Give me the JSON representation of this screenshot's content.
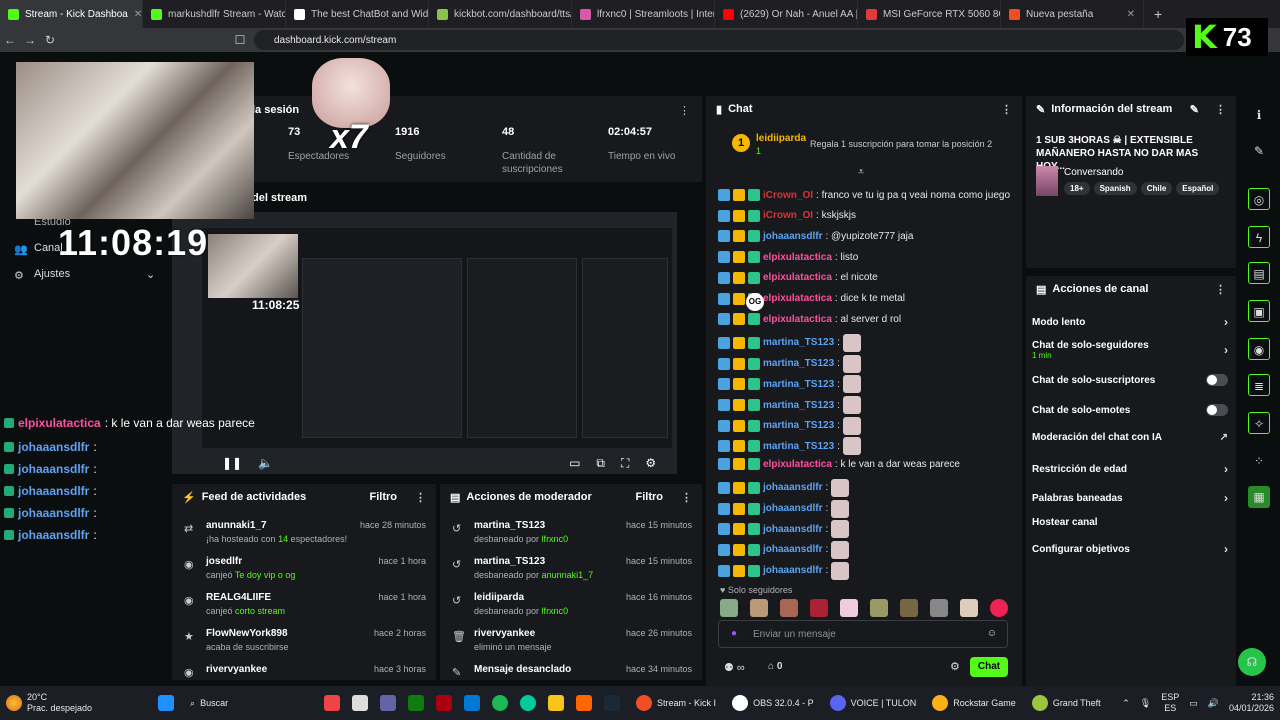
{
  "browser": {
    "tabs": [
      {
        "label": "Stream - Kick Dashboa",
        "color": "#53fc18",
        "active": true
      },
      {
        "label": "markushdlfr Stream - Watch L",
        "color": "#53fc18"
      },
      {
        "label": "The best ChatBot and Wid",
        "color": "#ffffff"
      },
      {
        "label": "kickbot.com/dashboard/tts/co",
        "color": "#8bc34a"
      },
      {
        "label": "lfrxnc0 | Streamloots | Interac",
        "color": "#d85aa6"
      },
      {
        "label": "(2629) Or Nah - Anuel AA | Sp",
        "color": "#ff0000"
      },
      {
        "label": "MSI GeForce RTX 5060 8G SHA",
        "color": "#e03a3a"
      },
      {
        "label": "Nueva pestaña",
        "color": "#f04e23"
      }
    ],
    "url": "dashboard.kick.com/stream"
  },
  "counter": {
    "logo": "K",
    "value": "73"
  },
  "overlay": {
    "clock": "11:08:19",
    "alert_text": "x7",
    "nav": [
      {
        "label": "Estudio"
      },
      {
        "label": "Canal"
      },
      {
        "label": "Ajustes"
      }
    ],
    "chat": [
      {
        "user": "elpixulatactica",
        "text": ": k le van a dar weas parece",
        "color": "#ff4fa0"
      },
      {
        "user": "johaaansdlfr",
        "text": ":",
        "color": "#5ba3f5"
      },
      {
        "user": "johaaansdlfr",
        "text": ":",
        "color": "#5ba3f5"
      },
      {
        "user": "johaaansdlfr",
        "text": ":",
        "color": "#5ba3f5"
      },
      {
        "user": "johaaansdlfr",
        "text": ":",
        "color": "#5ba3f5"
      },
      {
        "user": "johaaansdlfr",
        "text": ":",
        "color": "#5ba3f5"
      }
    ]
  },
  "session": {
    "title_fragment": "la sesión",
    "stats": [
      {
        "value": "73",
        "label": "Espectadores"
      },
      {
        "value": "1916",
        "label": "Seguidores"
      },
      {
        "value": "48",
        "label": "Cantidad de suscripciones"
      },
      {
        "value": "02:04:57",
        "label": "Tiempo en vivo"
      }
    ],
    "preview_title_fragment": "del stream",
    "preview_clock": "11:08:25"
  },
  "feed": {
    "title": "Feed de actividades",
    "filter": "Filtro",
    "items": [
      {
        "name": "anunnaki1_7",
        "pre": "¡ha hosteado con ",
        "hl": "14",
        "post": " espectadores!",
        "time": "hace 28 minutos",
        "icon": "⇄"
      },
      {
        "name": "josedlfr",
        "pre": "canjeó ",
        "hl": "Te doy vip o og",
        "post": "",
        "time": "hace 1 hora",
        "icon": "◉"
      },
      {
        "name": "REALG4LIIFE",
        "pre": "canjeó ",
        "hl": "corto stream",
        "post": "",
        "time": "hace 1 hora",
        "icon": "◉"
      },
      {
        "name": "FlowNewYork898",
        "pre": "acaba de suscribirse",
        "hl": "",
        "post": "",
        "time": "hace 2 horas",
        "icon": "★"
      },
      {
        "name": "rivervyankee",
        "pre": "",
        "hl": "",
        "post": "",
        "time": "hace 3 horas",
        "icon": "◉"
      }
    ]
  },
  "mod": {
    "title": "Acciones de moderador",
    "filter": "Filtro",
    "items": [
      {
        "name": "martina_TS123",
        "pre": "desbaneado por ",
        "hl": "lfrxnc0",
        "time": "hace 15 minutos",
        "icon": "↺"
      },
      {
        "name": "martina_TS123",
        "pre": "desbaneado por ",
        "hl": "anunnaki1_7",
        "time": "hace 15 minutos",
        "icon": "↺"
      },
      {
        "name": "leidiiparda",
        "pre": "desbaneado por ",
        "hl": "lfrxnc0",
        "time": "hace 16 minutos",
        "icon": "↺"
      },
      {
        "name": "rivervyankee",
        "pre": "eliminó un mensaje",
        "hl": "",
        "time": "hace 26 minutos",
        "icon": "🗑"
      },
      {
        "name": "Mensaje desanclado",
        "pre": "",
        "hl": "",
        "time": "hace 34 minutos",
        "icon": "✎"
      }
    ]
  },
  "chat": {
    "title": "Chat",
    "gifter": {
      "rank": "1",
      "name": "leidiiparda",
      "count": "1",
      "promo": "Regala 1 suscripción para tomar la posición 2"
    },
    "messages": [
      {
        "user": "iCrown_OI",
        "text": ": franco ve tu ig pa q veai noma como juego",
        "color": "#e03131",
        "emotes": 0
      },
      {
        "user": "iCrown_OI",
        "text": ": kskjskjs",
        "color": "#e03131",
        "emotes": 0
      },
      {
        "user": "johaaansdlfr",
        "text": ": @yupizote777 jaja",
        "color": "#5ba3f5",
        "emotes": 0
      },
      {
        "user": "elpixulatactica",
        "text": ": listo",
        "color": "#ff4fa0",
        "emotes": 0
      },
      {
        "user": "elpixulatactica",
        "text": ": el nicote",
        "color": "#ff4fa0",
        "emotes": 0
      },
      {
        "user": "elpixulatactica",
        "text": ": dice k te metal",
        "color": "#ff4fa0",
        "emotes": 0
      },
      {
        "user": "elpixulatactica",
        "text": ": al server d rol",
        "color": "#ff4fa0",
        "emotes": 0
      },
      {
        "user": "martina_TS123",
        "text": ":",
        "color": "#5ba3f5",
        "emotes": 1
      },
      {
        "user": "martina_TS123",
        "text": ":",
        "color": "#5ba3f5",
        "emotes": 1
      },
      {
        "user": "martina_TS123",
        "text": ":",
        "color": "#5ba3f5",
        "emotes": 1
      },
      {
        "user": "martina_TS123",
        "text": ":",
        "color": "#5ba3f5",
        "emotes": 1
      },
      {
        "user": "martina_TS123",
        "text": ":",
        "color": "#5ba3f5",
        "emotes": 1
      },
      {
        "user": "martina_TS123",
        "text": ":",
        "color": "#5ba3f5",
        "emotes": 1
      },
      {
        "user": "elpixulatactica",
        "text": ": k le van a dar weas parece",
        "color": "#ff4fa0",
        "emotes": 0
      },
      {
        "user": "johaaansdlfr",
        "text": ":",
        "color": "#5ba3f5",
        "emotes": 1
      },
      {
        "user": "johaaansdlfr",
        "text": ":",
        "color": "#5ba3f5",
        "emotes": 1
      },
      {
        "user": "johaaansdlfr",
        "text": ":",
        "color": "#5ba3f5",
        "emotes": 1
      },
      {
        "user": "johaaansdlfr",
        "text": ":",
        "color": "#5ba3f5",
        "emotes": 1
      },
      {
        "user": "johaaansdlfr",
        "text": ":",
        "color": "#5ba3f5",
        "emotes": 1
      }
    ],
    "og_badge": "OG",
    "followers_only": "Solo seguidores",
    "input_placeholder": "Enviar un mensaje",
    "points": "0",
    "send_label": "Chat"
  },
  "info": {
    "title": "Información del stream",
    "stream_title": "1 SUB 3HORAS ☠ | EXTENSIBLE MAÑANERO HASTA NO DAR MAS HOY...",
    "category": "Conversando",
    "tags": [
      "18+",
      "Spanish",
      "Chile",
      "Español"
    ]
  },
  "actions": {
    "title": "Acciones de canal",
    "items": [
      {
        "label": "Modo lento",
        "control": "chevron"
      },
      {
        "label": "Chat de solo-seguidores",
        "sub": "1 min",
        "control": "chevron"
      },
      {
        "label": "Chat de solo-suscriptores",
        "control": "toggle"
      },
      {
        "label": "Chat de solo-emotes",
        "control": "toggle"
      },
      {
        "label": "Moderación del chat con IA",
        "control": "external"
      },
      {
        "label": "Restricción de edad",
        "control": "chevron"
      },
      {
        "label": "Palabras baneadas",
        "control": "chevron"
      },
      {
        "label": "Hostear canal",
        "control": "none"
      },
      {
        "label": "Configurar objetivos",
        "control": "chevron"
      }
    ]
  },
  "taskbar": {
    "weather_temp": "20°C",
    "weather_desc": "Prac. despejado",
    "search": "Buscar",
    "apps": [
      {
        "label": "Stream - Kick I",
        "color": "#f04e23"
      },
      {
        "label": "OBS 32.0.4 - P",
        "color": "#ffffff"
      },
      {
        "label": "VOICE | TULON",
        "color": "#5865f2"
      },
      {
        "label": "Rockstar Game",
        "color": "#fcaf17"
      },
      {
        "label": "Grand Theft",
        "color": "#9bc53d"
      }
    ],
    "lang": "ESP",
    "lang2": "ES",
    "time": "21:36",
    "date": "04/01/2026"
  }
}
